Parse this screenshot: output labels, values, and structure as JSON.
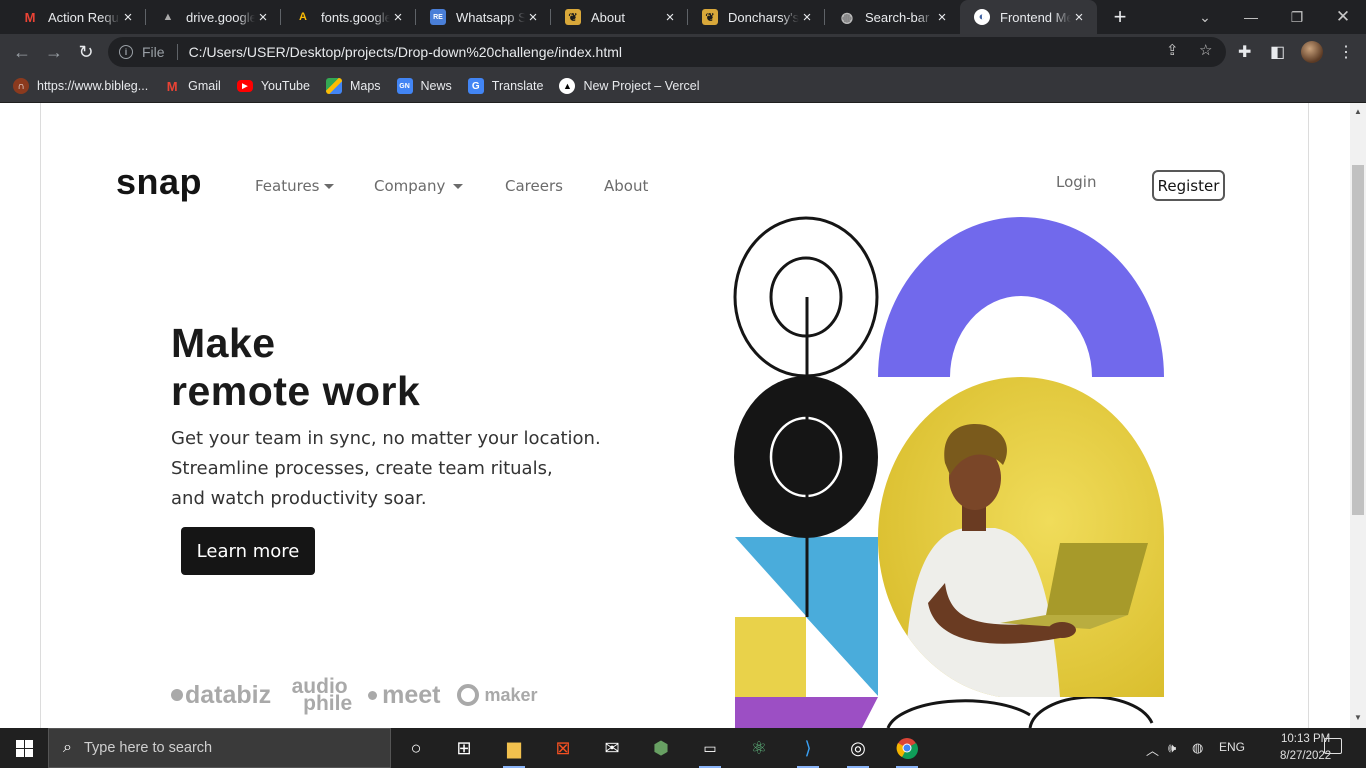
{
  "browser": {
    "tabs": [
      {
        "title": "Action Requir",
        "icon": "gmail-icon",
        "active": false
      },
      {
        "title": "drive.google.c",
        "icon": "drive-icon",
        "active": false
      },
      {
        "title": "fonts.google.c",
        "icon": "google-fonts-icon",
        "active": false
      },
      {
        "title": "Whatsapp SVG",
        "icon": "svgrepo-icon",
        "active": false
      },
      {
        "title": "About",
        "icon": "site-icon",
        "active": false
      },
      {
        "title": "Doncharsy's S",
        "icon": "site-icon",
        "active": false
      },
      {
        "title": "Search-bar",
        "icon": "globe-icon",
        "active": false
      },
      {
        "title": "Frontend Men",
        "icon": "frontend-mentor-icon",
        "active": true
      }
    ],
    "address": {
      "scheme_label": "File",
      "url": "C:/Users/USER/Desktop/projects/Drop-down%20challenge/index.html"
    },
    "bookmarks": [
      {
        "label": "https://www.bibleg...",
        "icon": "biblegateway-icon"
      },
      {
        "label": "Gmail",
        "icon": "gmail-icon"
      },
      {
        "label": "YouTube",
        "icon": "youtube-icon"
      },
      {
        "label": "Maps",
        "icon": "maps-icon"
      },
      {
        "label": "News",
        "icon": "news-icon"
      },
      {
        "label": "Translate",
        "icon": "translate-icon"
      },
      {
        "label": "New Project – Vercel",
        "icon": "vercel-icon"
      }
    ]
  },
  "page": {
    "logo": "snap",
    "nav": {
      "features": "Features",
      "company": "Company",
      "careers": "Careers",
      "about": "About",
      "login": "Login",
      "register": "Register"
    },
    "hero": {
      "title_line1": "Make",
      "title_line2": "remote work",
      "text_line1": "Get your team in sync, no matter your location.",
      "text_line2": "Streamline processes, create team rituals,",
      "text_line3": "and watch productivity soar.",
      "cta": "Learn more"
    },
    "clients": {
      "databiz": "databiz",
      "audiophile_top": "audio",
      "audiophile_bottom": "phile",
      "meet": "meet",
      "maker": "maker"
    },
    "colors": {
      "purple": "#7169ec",
      "yellow": "#e9d24a",
      "blue": "#4aacdb",
      "violet": "#9c4fc4",
      "dark": "#151515"
    }
  },
  "taskbar": {
    "search_placeholder": "Type here to search",
    "apps": [
      "cortana-icon",
      "task-view-icon",
      "file-explorer-icon",
      "store-icon",
      "mail-icon",
      "nodejs-icon",
      "terminal-icon",
      "atom-icon",
      "vscode-icon",
      "obs-icon",
      "chrome-icon"
    ],
    "language": "ENG",
    "time": "10:13 PM",
    "date": "8/27/2022"
  }
}
